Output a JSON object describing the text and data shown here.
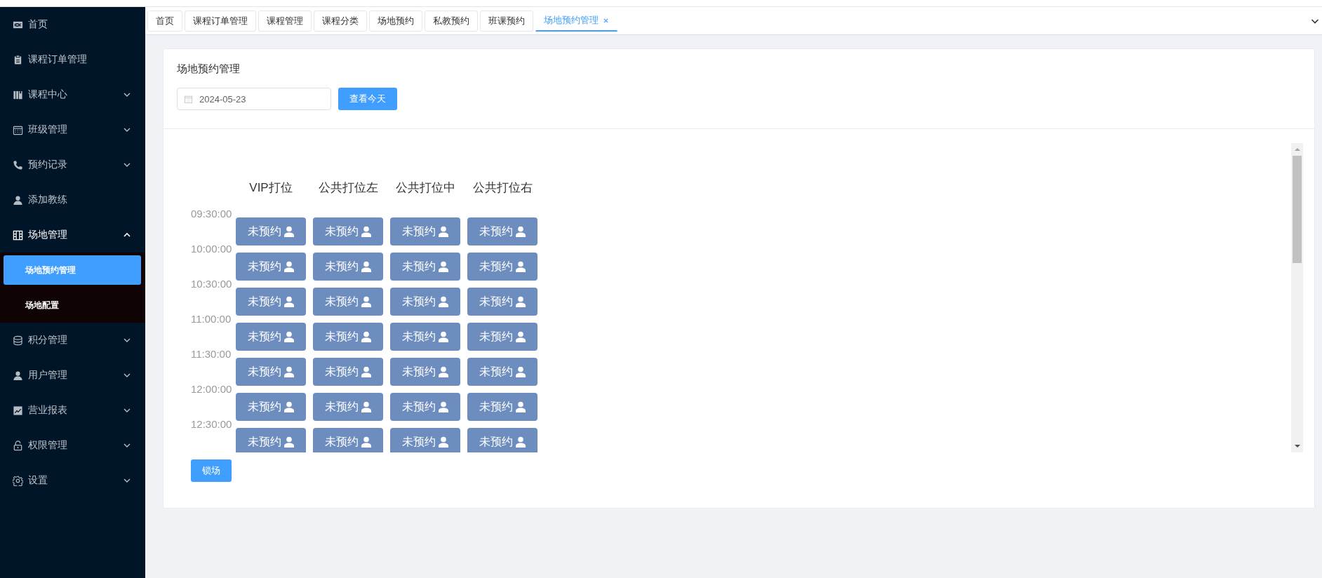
{
  "sidebar": {
    "items": [
      {
        "label": "首页"
      },
      {
        "label": "课程订单管理"
      },
      {
        "label": "课程中心",
        "expanded": false
      },
      {
        "label": "班级管理",
        "expanded": false
      },
      {
        "label": "预约记录",
        "expanded": false
      },
      {
        "label": "添加教练"
      },
      {
        "label": "场地管理",
        "expanded": true,
        "children": [
          {
            "label": "场地预约管理",
            "selected": true
          },
          {
            "label": "场地配置",
            "selected": false
          }
        ]
      },
      {
        "label": "积分管理",
        "expanded": false
      },
      {
        "label": "用户管理",
        "expanded": false
      },
      {
        "label": "营业报表",
        "expanded": false
      },
      {
        "label": "权限管理",
        "expanded": false
      },
      {
        "label": "设置",
        "expanded": false
      }
    ]
  },
  "tabs": [
    {
      "label": "首页",
      "selected": false
    },
    {
      "label": "课程订单管理",
      "selected": false
    },
    {
      "label": "课程管理",
      "selected": false
    },
    {
      "label": "课程分类",
      "selected": false
    },
    {
      "label": "场地预约",
      "selected": false
    },
    {
      "label": "私教预约",
      "selected": false
    },
    {
      "label": "班课预约",
      "selected": false
    },
    {
      "label": "场地预约管理",
      "selected": true
    }
  ],
  "page": {
    "title": "场地预约管理",
    "date_field": {
      "value": "2024-05-23"
    },
    "today_button": "查看今天",
    "lock_button": "锁场"
  },
  "schedule": {
    "columns": [
      "VIP打位",
      "公共打位左",
      "公共打位中",
      "公共打位右"
    ],
    "rows": [
      {
        "time": "09:30:00",
        "slots": [
          "未预约",
          "未预约",
          "未预约",
          "未预约"
        ]
      },
      {
        "time": "10:00:00",
        "slots": [
          "未预约",
          "未预约",
          "未预约",
          "未预约"
        ]
      },
      {
        "time": "10:30:00",
        "slots": [
          "未预约",
          "未预约",
          "未预约",
          "未预约"
        ]
      },
      {
        "time": "11:00:00",
        "slots": [
          "未预约",
          "未预约",
          "未预约",
          "未预约"
        ]
      },
      {
        "time": "11:30:00",
        "slots": [
          "未预约",
          "未预约",
          "未预约",
          "未预约"
        ]
      },
      {
        "time": "12:00:00",
        "slots": [
          "未预约",
          "未预约",
          "未预约",
          "未预约"
        ]
      },
      {
        "time": "12:30:00",
        "slots": [
          "未预约",
          "未预约",
          "未预约",
          "未预约"
        ]
      }
    ]
  }
}
